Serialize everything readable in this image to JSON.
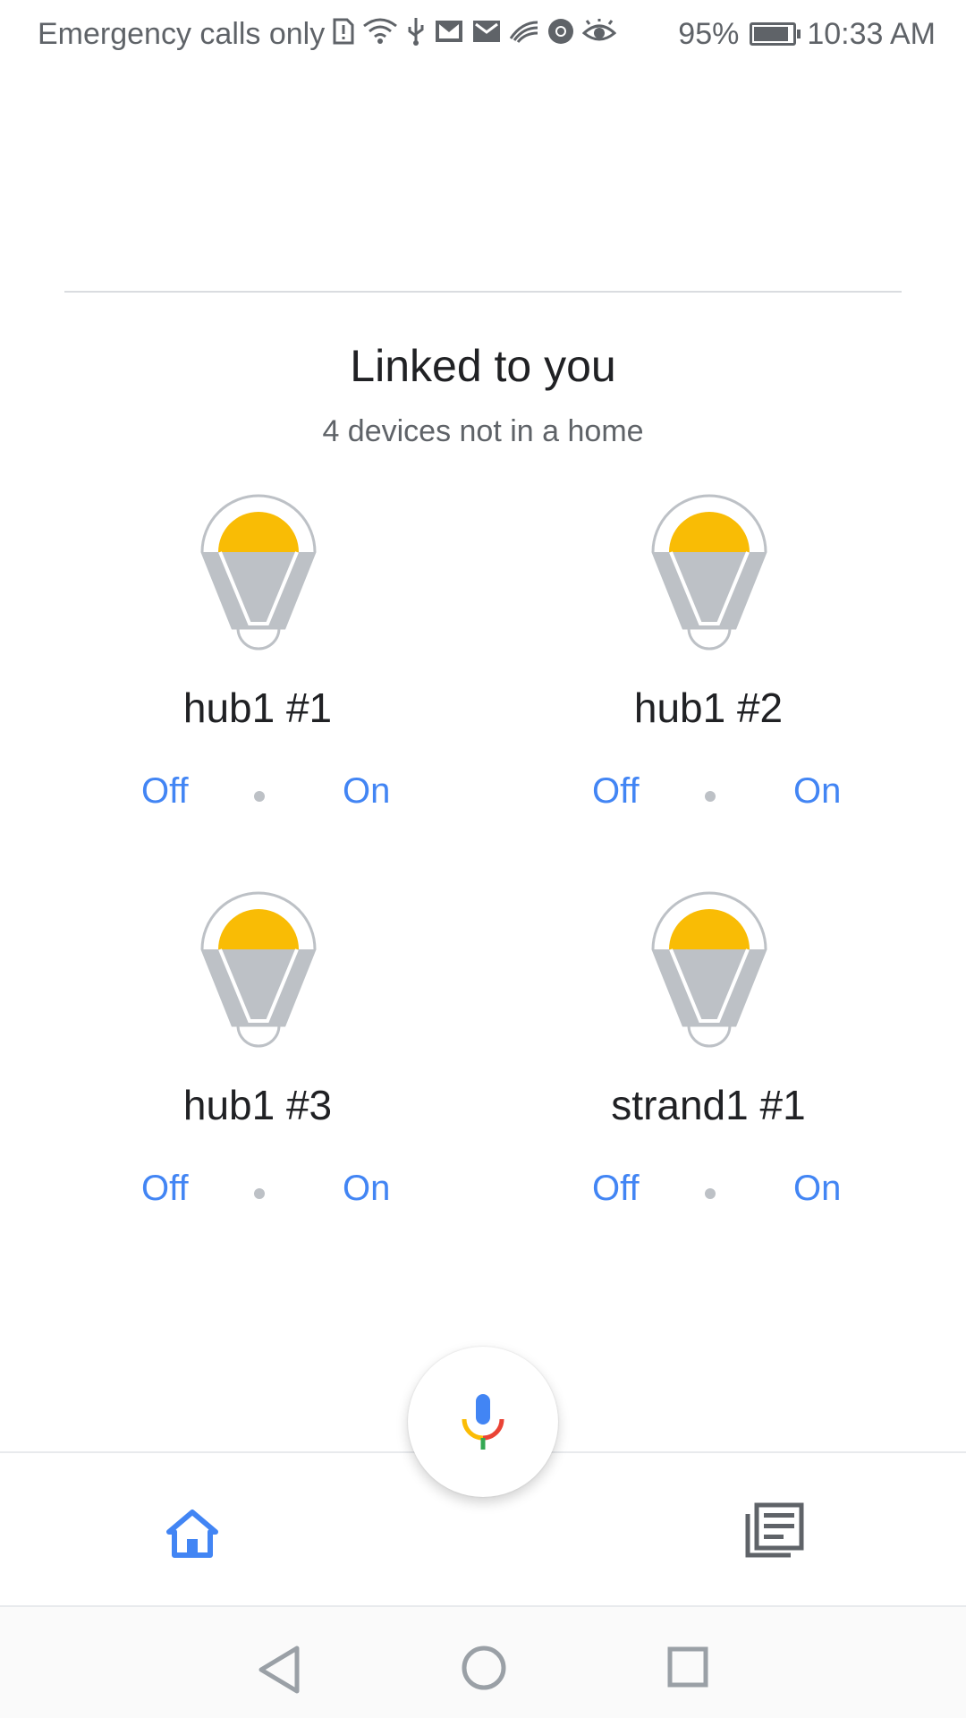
{
  "status_bar": {
    "carrier_text": "Emergency calls only",
    "battery_percent": "95%",
    "battery_level": 0.95,
    "time": "10:33 AM",
    "icons": [
      "sim-alert-icon",
      "wifi-icon",
      "usb-icon",
      "gmail-icon",
      "mail-icon",
      "swiftkey-icon",
      "chrome-icon",
      "eye-comfort-icon",
      "battery-charging-icon"
    ]
  },
  "section": {
    "title": "Linked to you",
    "subtitle": "4 devices not in a home"
  },
  "devices": [
    {
      "name": "hub1 #1",
      "off_label": "Off",
      "on_label": "On",
      "icon": "light-bulb-icon"
    },
    {
      "name": "hub1 #2",
      "off_label": "Off",
      "on_label": "On",
      "icon": "light-bulb-icon"
    },
    {
      "name": "hub1 #3",
      "off_label": "Off",
      "on_label": "On",
      "icon": "light-bulb-icon"
    },
    {
      "name": "strand1 #1",
      "off_label": "Off",
      "on_label": "On",
      "icon": "light-bulb-icon"
    }
  ],
  "bottom_nav": {
    "tabs": [
      {
        "icon": "home-icon",
        "active": true
      },
      {
        "icon": "feed-icon",
        "active": false
      }
    ],
    "mic_icon": "google-mic-icon"
  },
  "colors": {
    "accent": "#4285f4",
    "bulb_top": "#f9bc05",
    "bulb_body": "#bdc1c6",
    "text_primary": "#202124",
    "text_secondary": "#5f6368"
  }
}
